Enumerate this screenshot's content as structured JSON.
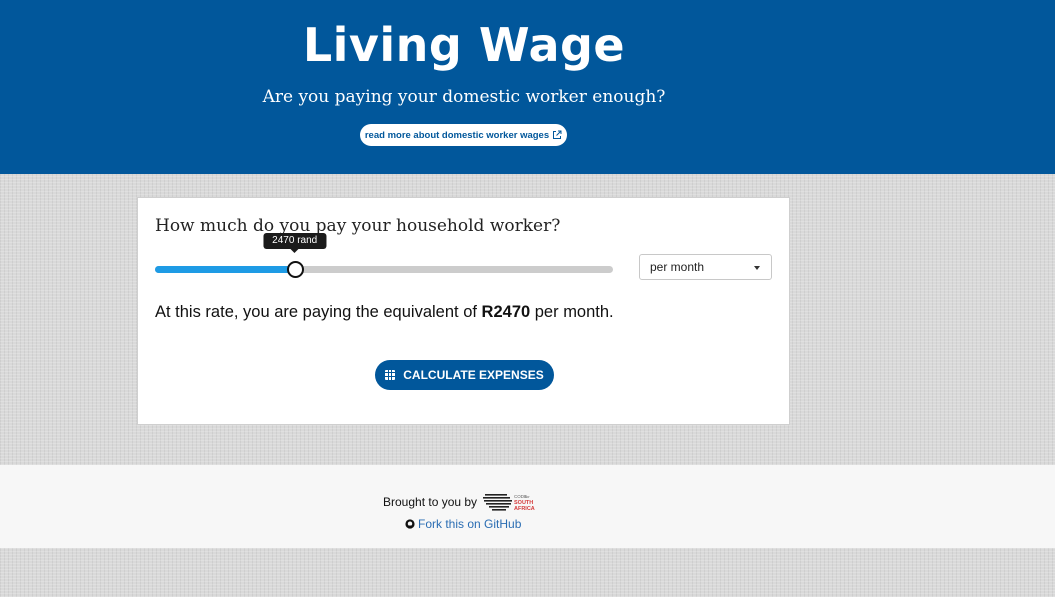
{
  "header": {
    "title": "Living Wage",
    "subtitle": "Are you paying your domestic worker enough?",
    "read_more_label": "read more about domestic worker wages",
    "background_color": "#01579b"
  },
  "form": {
    "question": "How much do you pay your household worker?",
    "slider": {
      "value": 2470,
      "fill_fraction": 0.305,
      "tooltip": "2470 rand",
      "fill_color": "#1e9be5"
    },
    "period_select": {
      "selected": "per month"
    },
    "result": {
      "prefix": "At this rate, you are paying the equivalent of ",
      "amount": "R2470",
      "suffix": " per month."
    },
    "calculate_button_label": "CALCULATE EXPENSES",
    "calculate_icon": "calculator-icon"
  },
  "footer": {
    "brought_by": "Brought to you by",
    "logo_text": {
      "line1": "CODE",
      "line2": "for",
      "line3": "SOUTH",
      "line4": "AFRICA"
    },
    "fork_label": "Fork this on GitHub",
    "fork_icon": "github-icon",
    "link_color": "#2a6db3"
  }
}
